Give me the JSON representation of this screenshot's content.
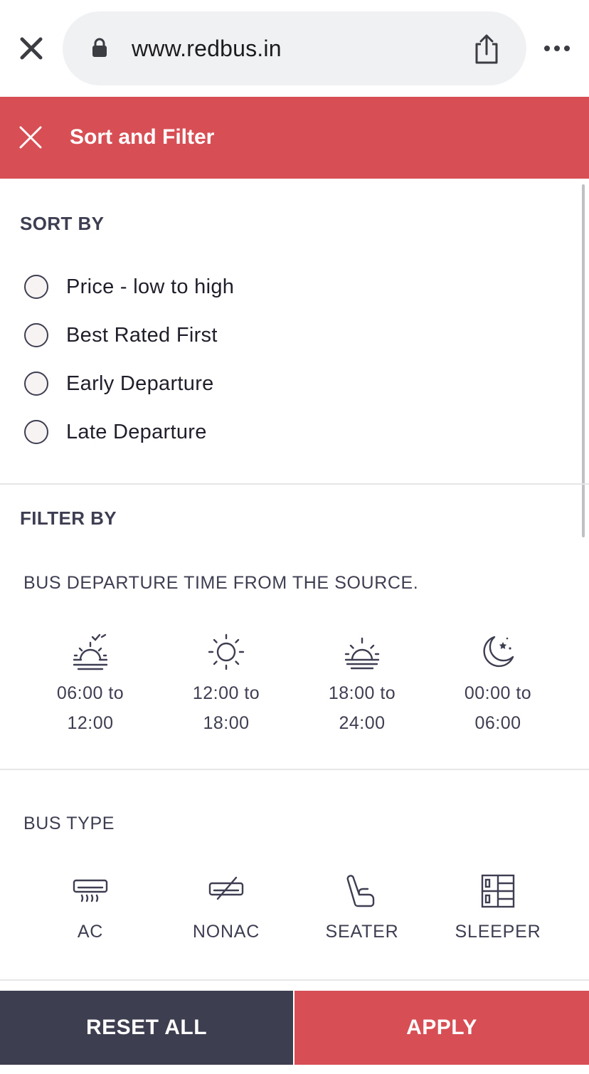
{
  "browser": {
    "url": "www.redbus.in",
    "close_icon": "close-icon",
    "lock_icon": "lock-icon",
    "share_icon": "share-icon",
    "more_icon": "more-dots-icon"
  },
  "header": {
    "title": "Sort and Filter",
    "accent_color": "#d84e55"
  },
  "sort": {
    "title": "SORT BY",
    "options": [
      {
        "label": "Price - low to high",
        "selected": false
      },
      {
        "label": "Best Rated First",
        "selected": false
      },
      {
        "label": "Early Departure",
        "selected": false
      },
      {
        "label": "Late Departure",
        "selected": false
      }
    ]
  },
  "filter": {
    "title": "FILTER BY",
    "departure": {
      "title": "BUS DEPARTURE TIME FROM THE SOURCE.",
      "options": [
        {
          "icon": "sunrise-icon",
          "line1": "06:00 to",
          "line2": "12:00"
        },
        {
          "icon": "sun-icon",
          "line1": "12:00 to",
          "line2": "18:00"
        },
        {
          "icon": "sunset-icon",
          "line1": "18:00 to",
          "line2": "24:00"
        },
        {
          "icon": "moon-icon",
          "line1": "00:00 to",
          "line2": "06:00"
        }
      ]
    },
    "bus_type": {
      "title": "BUS TYPE",
      "options": [
        {
          "icon": "ac-icon",
          "label": "AC"
        },
        {
          "icon": "non-ac-icon",
          "label": "NONAC"
        },
        {
          "icon": "seater-icon",
          "label": "SEATER"
        },
        {
          "icon": "sleeper-icon",
          "label": "SLEEPER"
        }
      ]
    }
  },
  "footer": {
    "reset_label": "RESET ALL",
    "apply_label": "APPLY",
    "reset_color": "#3d3e50",
    "apply_color": "#d84e55"
  }
}
